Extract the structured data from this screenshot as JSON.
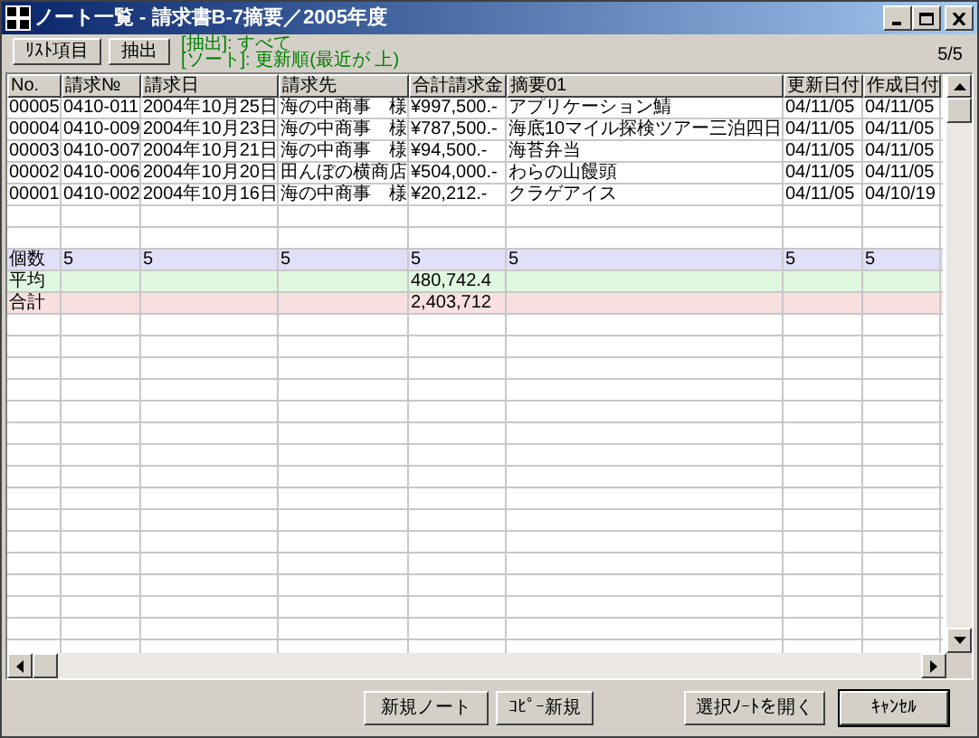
{
  "window": {
    "title": "ノート一覧 - 請求書B-7摘要／2005年度"
  },
  "toolbar": {
    "buttons": [
      "ﾘｽﾄ項目",
      "抽出"
    ],
    "filter_lines": [
      "[抽出]: すべて",
      "[ソート]: 更新順(最近が 上)"
    ],
    "count": "5/5"
  },
  "table": {
    "columns": [
      "No.",
      "請求№",
      "請求日",
      "請求先",
      "合計請求金",
      "摘要01",
      "更新日付",
      "作成日付"
    ],
    "rows": [
      {
        "cells": [
          "00005",
          "0410-011",
          "2004年10月25日",
          "海の中商事　様",
          "¥997,500.-",
          "アプリケーション鯖",
          "04/11/05",
          "04/11/05"
        ]
      },
      {
        "cells": [
          "00004",
          "0410-009",
          "2004年10月23日",
          "海の中商事　様",
          "¥787,500.-",
          "海底10マイル探検ツアー三泊四日",
          "04/11/05",
          "04/11/05"
        ]
      },
      {
        "cells": [
          "00003",
          "0410-007",
          "2004年10月21日",
          "海の中商事　様",
          "¥94,500.-",
          "海苔弁当",
          "04/11/05",
          "04/11/05"
        ]
      },
      {
        "cells": [
          "00002",
          "0410-006",
          "2004年10月20日",
          "田んぼの横商店",
          "¥504,000.-",
          "わらの山饅頭",
          "04/11/05",
          "04/11/05"
        ]
      },
      {
        "cells": [
          "00001",
          "0410-002",
          "2004年10月16日",
          "海の中商事　様",
          "¥20,212.-",
          "クラゲアイス",
          "04/11/05",
          "04/10/19"
        ]
      }
    ],
    "summary_rows": [
      {
        "color": "#e0e0f8",
        "cells": [
          "個数",
          "5",
          "5",
          "5",
          "5",
          "5",
          "5",
          "5"
        ]
      },
      {
        "color": "#e0f8e0",
        "cells": [
          "平均",
          "",
          "",
          "",
          "480,742.4",
          "",
          "",
          ""
        ]
      },
      {
        "color": "#f8e0e0",
        "cells": [
          "合計",
          "",
          "",
          "",
          "2,403,712",
          "",
          "",
          ""
        ]
      }
    ]
  },
  "buttons": [
    {
      "label": "新規ノート",
      "default": false
    },
    {
      "label": "ｺﾋﾟｰ新規",
      "default": false
    },
    {
      "label": "選択ﾉｰﾄを開く",
      "default": false
    },
    {
      "label": "ｷｬﾝｾﾙ",
      "default": true
    }
  ]
}
